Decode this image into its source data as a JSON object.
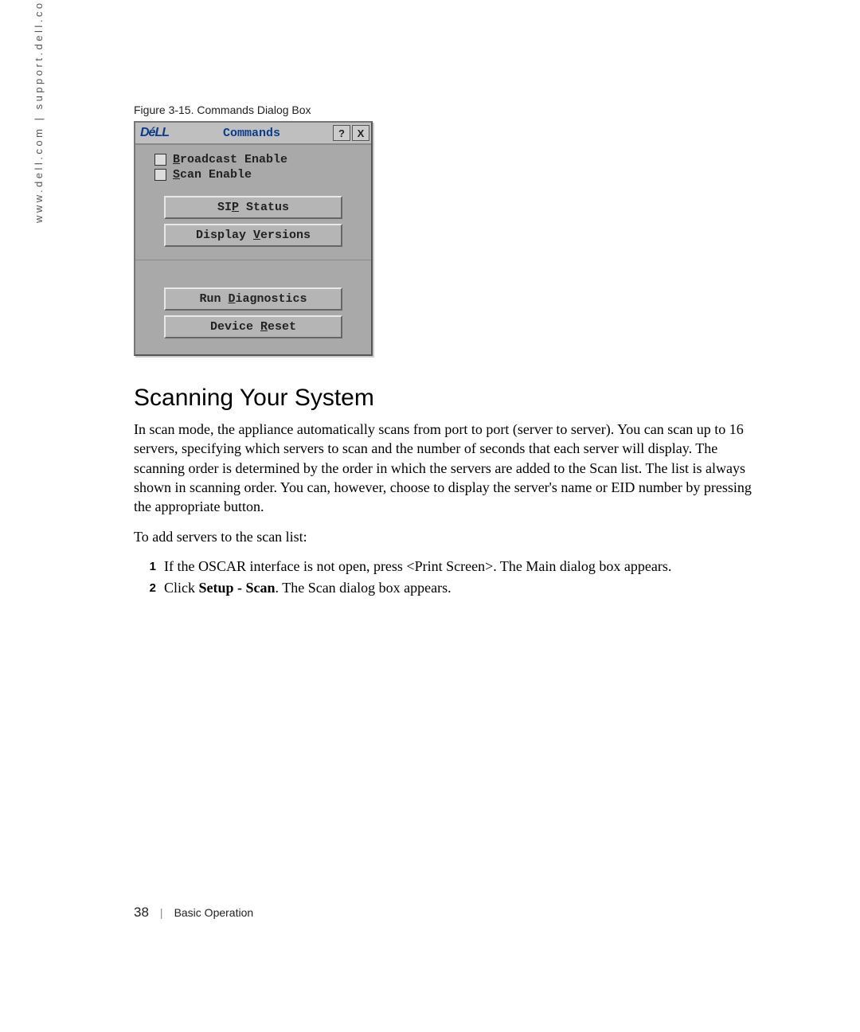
{
  "sidebar": "www.dell.com | support.dell.com",
  "figure_caption": "Figure 3-15.    Commands Dialog Box",
  "dialog": {
    "logo": "DéLL",
    "title": "Commands",
    "help_btn": "?",
    "close_btn": "X",
    "checks": {
      "broadcast_pre": "B",
      "broadcast_rest": "roadcast Enable",
      "scan_pre": "S",
      "scan_rest": "can Enable"
    },
    "buttons": {
      "sip_pre": "SI",
      "sip_u": "P",
      "sip_post": " Status",
      "ver_pre": "Display ",
      "ver_u": "V",
      "ver_post": "ersions",
      "diag_pre": "Run ",
      "diag_u": "D",
      "diag_post": "iagnostics",
      "reset_pre": "Device ",
      "reset_u": "R",
      "reset_post": "eset"
    }
  },
  "heading": "Scanning Your System",
  "para1": "In scan mode, the appliance automatically scans from port to port (server to server). You can scan up to 16 servers, specifying which servers to scan and the number of seconds that each server will display. The scanning order is determined by the order in which the servers are added to the Scan list. The list is always shown in scanning order. You can, however, choose to display the server's name or EID number by pressing the appropriate button.",
  "para2": "To add servers to the scan list:",
  "steps": [
    {
      "n": "1",
      "text": "If the OSCAR interface is not open, press <Print Screen>. The Main dialog box appears."
    },
    {
      "n": "2",
      "pre": "Click ",
      "bold": "Setup - Scan",
      "post": ". The Scan dialog box appears."
    }
  ],
  "footer": {
    "page": "38",
    "section": "Basic Operation"
  }
}
